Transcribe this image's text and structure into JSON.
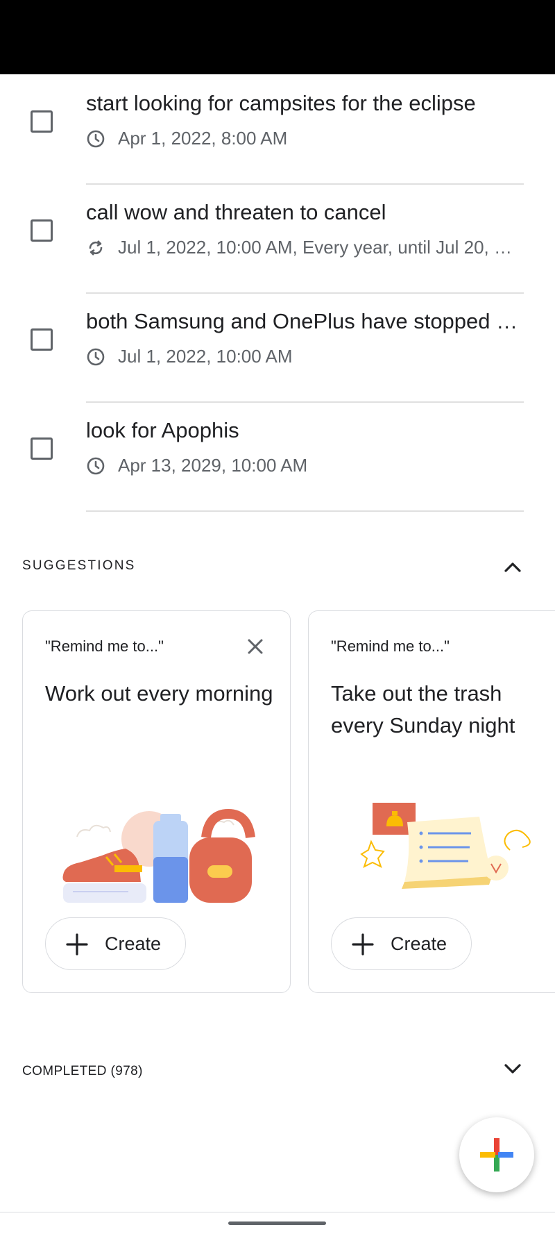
{
  "tasks": [
    {
      "title": "start looking for campsites for the eclipse",
      "date": "Apr 1, 2022, 8:00 AM",
      "icon": "clock-icon"
    },
    {
      "title": "call wow and threaten to cancel",
      "date": "Jul 1, 2022, 10:00 AM, Every year, until Jul 20, …",
      "icon": "repeat-icon"
    },
    {
      "title": "both Samsung and OnePlus have stopped …",
      "date": "Jul 1, 2022, 10:00 AM",
      "icon": "clock-icon"
    },
    {
      "title": "look for Apophis",
      "date": "Apr 13, 2029, 10:00 AM",
      "icon": "clock-icon"
    }
  ],
  "suggestions": {
    "header": "SUGGESTIONS",
    "cards": [
      {
        "quote": "\"Remind me to...\"",
        "text": "Work out every morning",
        "button": "Create"
      },
      {
        "quote": "\"Remind me to...\"",
        "text": "Take out the trash every Sunday night",
        "button": "Create"
      }
    ]
  },
  "completed": {
    "header": "COMPLETED (978)"
  },
  "colors": {
    "google_blue": "#4285F4",
    "google_red": "#EA4335",
    "google_yellow": "#FBBC04",
    "google_green": "#34A853"
  }
}
